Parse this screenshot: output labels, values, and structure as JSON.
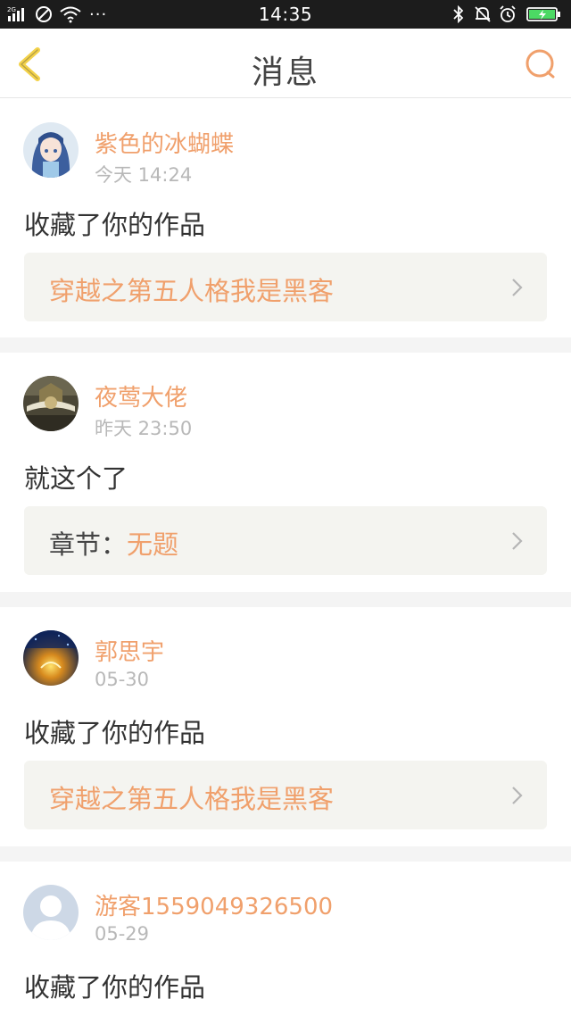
{
  "status_bar": {
    "network_label": "2G",
    "time": "14:35",
    "more_dots": "···"
  },
  "header": {
    "title": "消息",
    "back_icon": "chevron-left-icon",
    "search_icon": "search-icon",
    "accent_color": "#f0a06c"
  },
  "messages": [
    {
      "name": "紫色的冰蝴蝶",
      "time": "今天 14:24",
      "action": "收藏了你的作品",
      "work_prefix": "",
      "work_title": "穿越之第五人格我是黑客"
    },
    {
      "name": "夜莺大佬",
      "time": "昨天 23:50",
      "action": "就这个了",
      "work_prefix": "章节：",
      "work_title": "无题"
    },
    {
      "name": "郭思宇",
      "time": "05-30",
      "action": "收藏了你的作品",
      "work_prefix": "",
      "work_title": "穿越之第五人格我是黑客"
    },
    {
      "name": "游客1559049326500",
      "time": "05-29",
      "action": "收藏了你的作品"
    }
  ]
}
